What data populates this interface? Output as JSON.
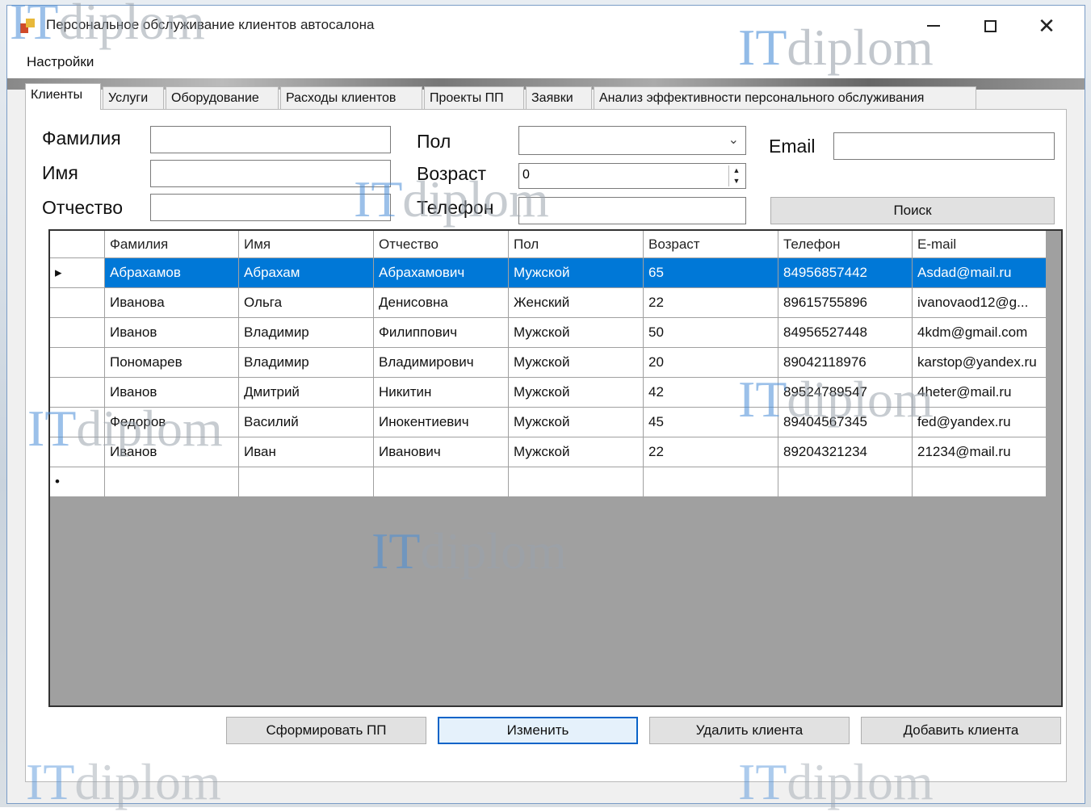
{
  "window": {
    "title": "Персональное обслуживание клиентов автосалона",
    "menu": [
      "Настройки"
    ]
  },
  "tabs": [
    {
      "label": "Клиенты",
      "active": true
    },
    {
      "label": "Услуги",
      "active": false
    },
    {
      "label": "Оборудование",
      "active": false
    },
    {
      "label": "Расходы клиентов",
      "active": false
    },
    {
      "label": "Проекты ПП",
      "active": false
    },
    {
      "label": "Заявки",
      "active": false
    },
    {
      "label": "Анализ эффективности персонального обслуживания",
      "active": false
    }
  ],
  "form": {
    "surname_label": "Фамилия",
    "name_label": "Имя",
    "patronymic_label": "Отчество",
    "gender_label": "Пол",
    "age_label": "Возраст",
    "age_value": "0",
    "phone_label": "Телефон",
    "email_label": "Email",
    "search_button": "Поиск"
  },
  "table": {
    "columns": [
      "Фамилия",
      "Имя",
      "Отчество",
      "Пол",
      "Возраст",
      "Телефон",
      "E-mail"
    ],
    "rows": [
      [
        "Абрахамов",
        "Абрахам",
        "Абрахамович",
        "Мужской",
        "65",
        "84956857442",
        "Asdad@mail.ru"
      ],
      [
        "Иванова",
        "Ольга",
        "Денисовна",
        "Женский",
        "22",
        "89615755896",
        "ivanovaod12@g..."
      ],
      [
        "Иванов",
        "Владимир",
        "Филиппович",
        "Мужской",
        "50",
        "84956527448",
        "4kdm@gmail.com"
      ],
      [
        "Пономарев",
        "Владимир",
        "Владимирович",
        "Мужской",
        "20",
        "89042118976",
        "karstop@yandex.ru"
      ],
      [
        "Иванов",
        "Дмитрий",
        "Никитин",
        "Мужской",
        "42",
        "89524789547",
        "4heter@mail.ru"
      ],
      [
        "Федоров",
        "Василий",
        "Инокентиевич",
        "Мужской",
        "45",
        "89404567345",
        "fed@yandex.ru"
      ],
      [
        "Иванов",
        "Иван",
        "Иванович",
        "Мужской",
        "22",
        "89204321234",
        "21234@mail.ru"
      ]
    ],
    "selected_row": 0,
    "current_row_marker": "▸",
    "new_row_marker": "•"
  },
  "actions": {
    "generate": "Сформировать ПП",
    "edit": "Изменить",
    "delete": "Удалить клиента",
    "add": "Добавить клиента"
  },
  "watermark": {
    "it": "IT",
    "diplom": "diplom"
  },
  "colors": {
    "selection": "#0078d7",
    "grid_bg": "#a0a0a0",
    "watermark_it": "#4a8ed8"
  }
}
